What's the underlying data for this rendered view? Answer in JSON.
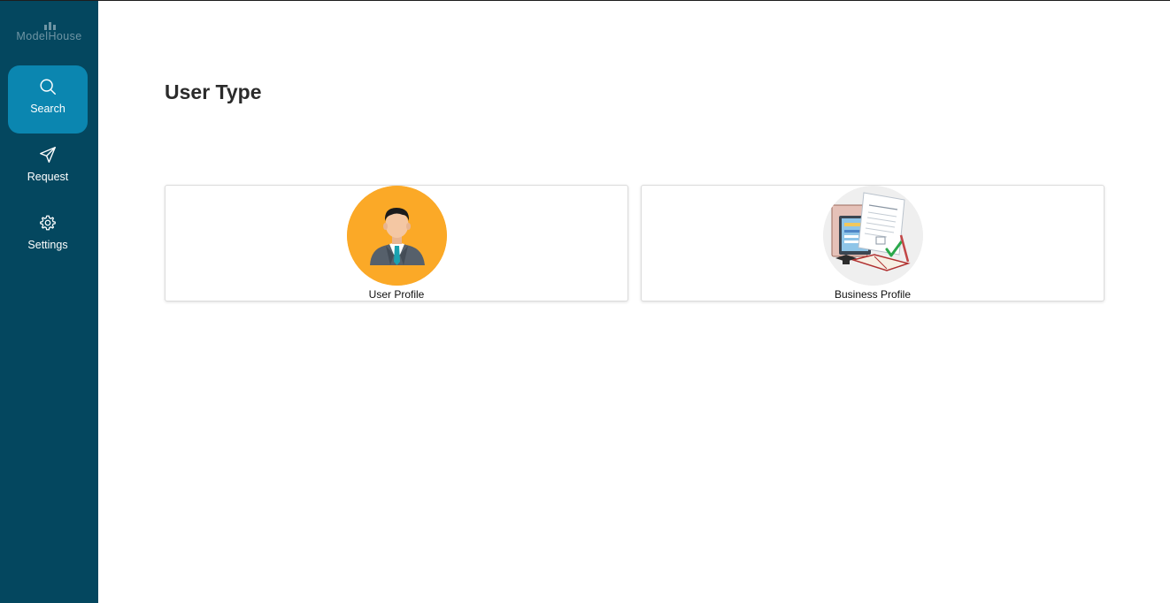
{
  "app": {
    "logo_text": "ModelHouse"
  },
  "sidebar": {
    "items": [
      {
        "label": "Search",
        "icon": "search-icon",
        "active": true
      },
      {
        "label": "Request",
        "icon": "send-icon",
        "active": false
      },
      {
        "label": "Settings",
        "icon": "gear-icon",
        "active": false
      }
    ]
  },
  "main": {
    "title": "User Type",
    "cards": [
      {
        "label": "User Profile",
        "icon": "user-avatar-icon"
      },
      {
        "label": "Business Profile",
        "icon": "business-documents-icon"
      }
    ]
  },
  "colors": {
    "sidebar_bg": "#04475f",
    "active_item_bg": "#0b86b0",
    "user_avatar_bg": "#fba927",
    "business_avatar_bg": "#efefef"
  }
}
